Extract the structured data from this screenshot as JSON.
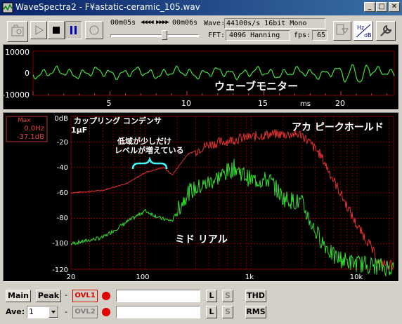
{
  "window": {
    "title": "WaveSpectra2 - F¥astatic-ceramic_105.wav",
    "buttons": {
      "minimize": "_",
      "maximize": "□",
      "close": "✕"
    }
  },
  "toolbar": {
    "time_start": "00m05s",
    "time_end": "00m06s",
    "nav_arrows": "◀◀◀◀ ▶▶▶▶",
    "wave_label": "Wave:",
    "wave_value": "44100s/s 16bit Mono",
    "fft_label": "FFT:",
    "fft_value": "4096 Hanning",
    "fps_label": "fps:",
    "fps_value": "65",
    "hz_db_label": "Hz/dB",
    "seek_position": 0.62
  },
  "wave_monitor": {
    "y_labels": [
      "10000",
      "0",
      "-10000"
    ],
    "x_labels": [
      "5",
      "10",
      "15",
      "20"
    ],
    "x_unit": "ms",
    "caption": "ウェーブモニター"
  },
  "spectrum": {
    "y_unit": "0dB",
    "y_labels": [
      "-20",
      "-40",
      "-60",
      "-80",
      "-100",
      "-120"
    ],
    "x_labels": [
      "20",
      "100",
      "1k",
      "10k"
    ],
    "max_box": {
      "title": "Max",
      "freq": "0.0Hz",
      "level": "-37.1dB"
    },
    "annotations": {
      "coupling": "カップリング コンデンサ",
      "coupling2": "1μF",
      "lowband": "低域が少しだけ",
      "lowband2": "レベルが増えている",
      "red_label": "アカ ピークホールド",
      "green_label": "ミド リアル"
    },
    "colors": {
      "red": "#e03030",
      "green": "#30e030",
      "grid": "#800000",
      "axis_text": "#ffffff"
    }
  },
  "bottom": {
    "main": "Main",
    "peak": "Peak",
    "ovl1": "OVL1",
    "ovl2": "OVL2",
    "ave_label": "Ave:",
    "ave_value": "1",
    "l": "L",
    "s": "S",
    "thd": "THD",
    "rms": "RMS",
    "dash": "-"
  }
}
